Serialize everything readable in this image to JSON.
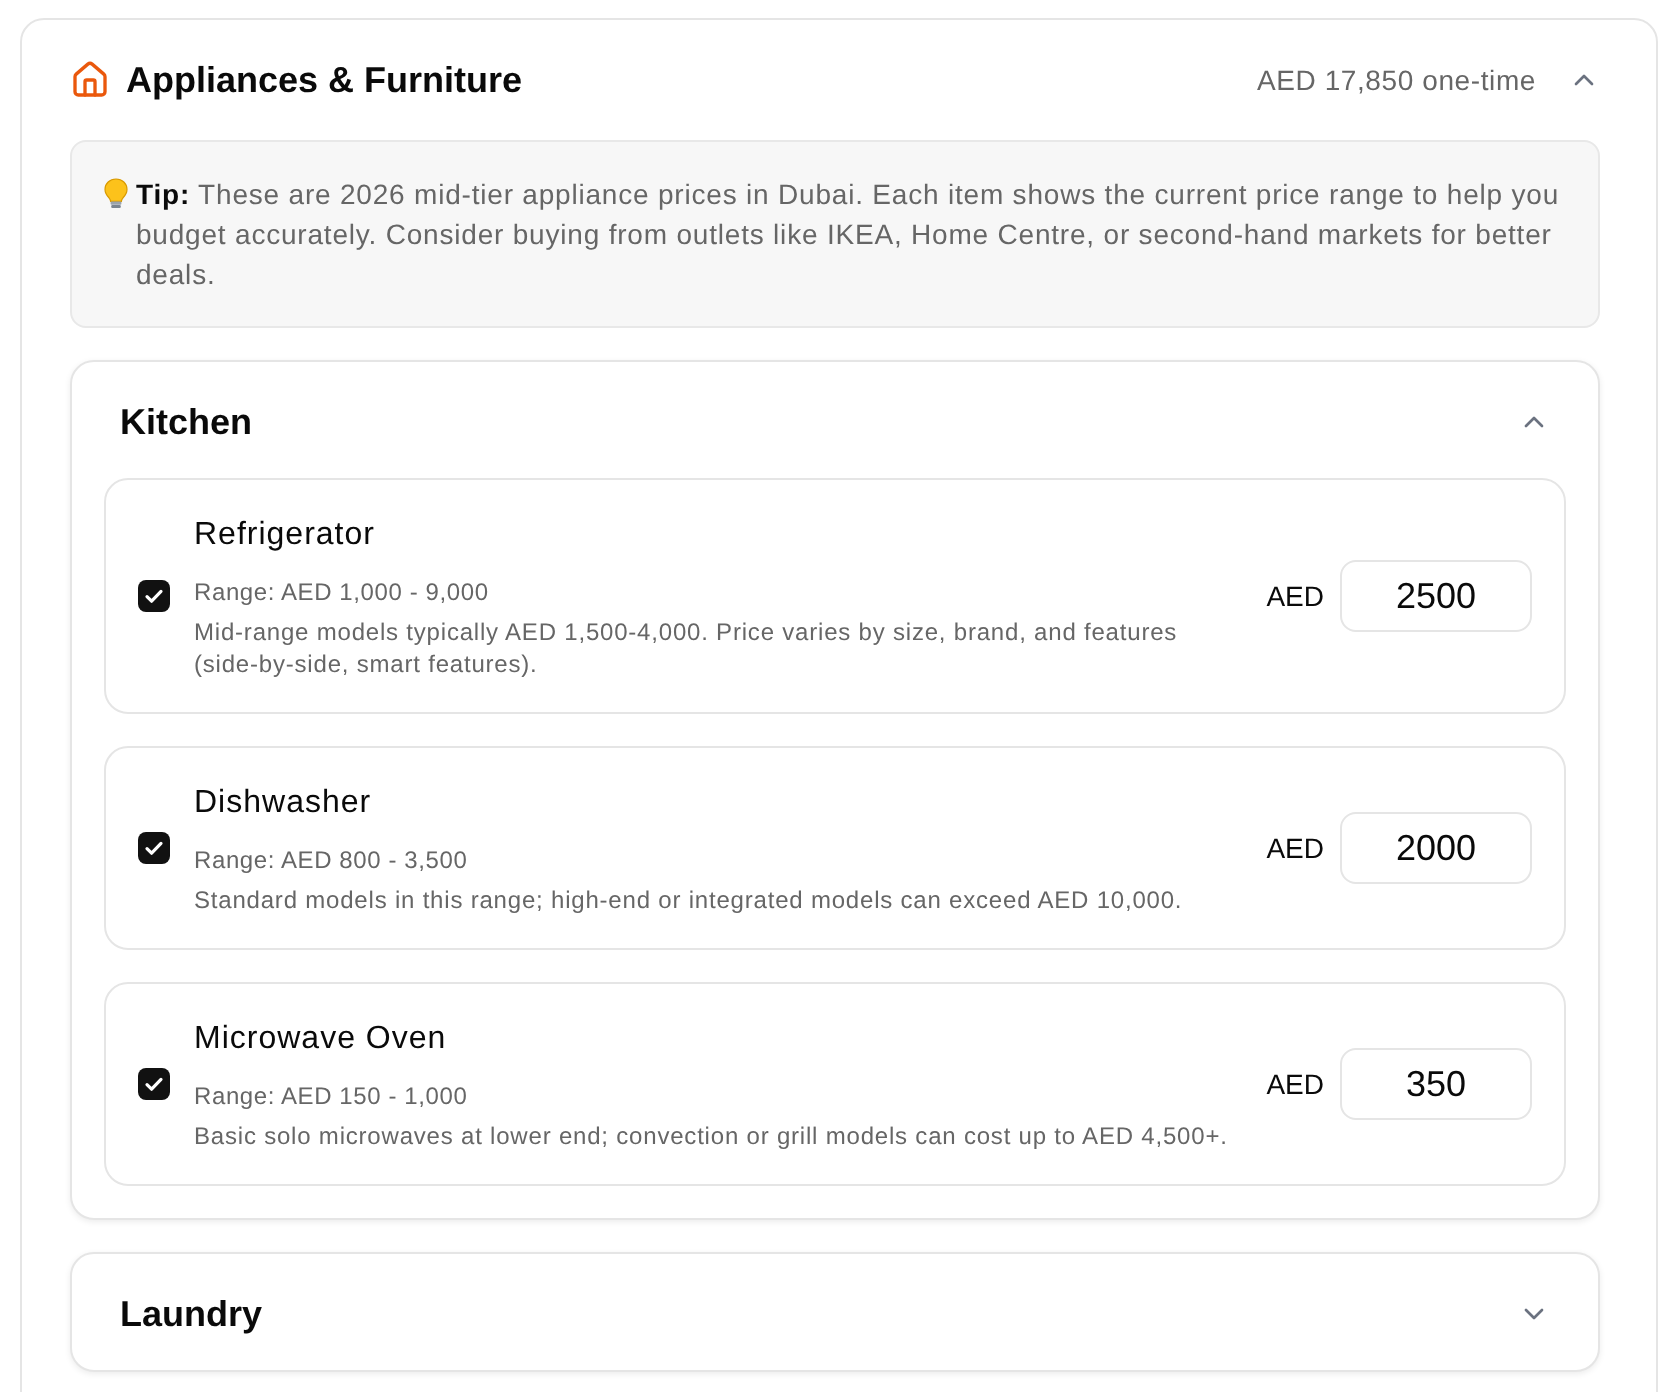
{
  "section": {
    "title": "Appliances & Furniture",
    "total": "AED 17,850 one-time",
    "expanded": true
  },
  "tip": {
    "text": "**Tip:** These are 2026 mid-tier appliance prices in Dubai. Each item shows the current price range to help you budget accurately. Consider buying from outlets like IKEA, Home Centre, or second-hand markets for better deals."
  },
  "groups": [
    {
      "title": "Kitchen",
      "expanded": true,
      "items": [
        {
          "name": "Refrigerator",
          "checked": true,
          "range": "Range: AED 1,000 - 9,000",
          "note": "Mid-range models typically AED 1,500-4,000. Price varies by size, brand, and features (side-by-side, smart features).",
          "currency": "AED",
          "value": "2500"
        },
        {
          "name": "Dishwasher",
          "checked": true,
          "range": "Range: AED 800 - 3,500",
          "note": "Standard models in this range; high-end or integrated models can exceed AED 10,000.",
          "currency": "AED",
          "value": "2000"
        },
        {
          "name": "Microwave Oven",
          "checked": true,
          "range": "Range: AED 150 - 1,000",
          "note": "Basic solo microwaves at lower end; convection or grill models can cost up to AED 4,500+.",
          "currency": "AED",
          "value": "350"
        }
      ]
    },
    {
      "title": "Laundry",
      "expanded": false
    }
  ]
}
